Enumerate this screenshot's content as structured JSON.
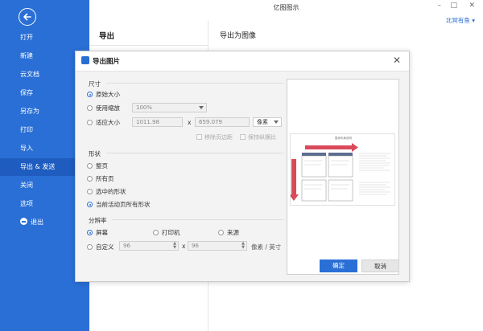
{
  "app": {
    "title": "亿图图示",
    "user": "北冥有鱼 ▾"
  },
  "window_controls": {
    "minimize": "–",
    "maximize": "□",
    "close": "✕"
  },
  "sidebar": {
    "items": [
      {
        "label": "打开"
      },
      {
        "label": "新建"
      },
      {
        "label": "云文档"
      },
      {
        "label": "保存"
      },
      {
        "label": "另存为"
      },
      {
        "label": "打印"
      },
      {
        "label": "导入"
      },
      {
        "label": "导出 & 发送"
      },
      {
        "label": "关闭"
      },
      {
        "label": "选项"
      },
      {
        "label": "退出"
      }
    ]
  },
  "main": {
    "page_title": "导出",
    "section_title": "导出为图像"
  },
  "dialog": {
    "title": "导出图片",
    "size_group": {
      "label": "尺寸",
      "original": "原始大小",
      "zoom": "使用缩放",
      "zoom_value": "100%",
      "fit": "适应大小",
      "width": "1011.98",
      "x_sep": "x",
      "height": "659.079",
      "unit": "像素",
      "remove_margin": "移除页边距",
      "keep_ratio": "保持纵横比"
    },
    "shape_group": {
      "label": "形状",
      "whole_page": "整页",
      "all_pages": "所有页",
      "selected": "选中的形状",
      "current_all": "当前活动页所有形状"
    },
    "resolution_group": {
      "label": "分辨率",
      "screen": "屏幕",
      "printer": "打印机",
      "source": "来源",
      "custom": "自定义",
      "dpi_x": "96",
      "x_sep": "x",
      "dpi_y": "96",
      "unit": "像素 / 英寸"
    },
    "preview_title": "整体布局说明",
    "ok": "确定",
    "cancel": "取消"
  }
}
